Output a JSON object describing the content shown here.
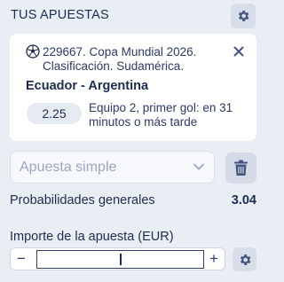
{
  "header": {
    "title": "TUS APUESTAS",
    "settings_icon": "gear-icon"
  },
  "bet": {
    "sport_icon": "soccer-ball-icon",
    "event": "229667. Copa Mundial 2026. Clasificación. Sudamérica.",
    "match": "Ecuador - Argentina",
    "odds": "2.25",
    "selection": "Equipo 2, primer gol: en 31 minutos o más tarde",
    "remove_icon": "close-icon"
  },
  "bet_type": {
    "selected": "Apuesta simple",
    "dropdown_icon": "chevron-down-icon",
    "delete_icon": "trash-icon"
  },
  "summary": {
    "probabilities_label": "Probabilidades generales",
    "probabilities_value": "3.04"
  },
  "stake": {
    "label": "Importe de la apuesta (EUR)",
    "value": "",
    "minus": "−",
    "plus": "+",
    "settings_icon": "gear-icon"
  },
  "colors": {
    "background": "#e9eef4",
    "text": "#1c2c4f",
    "card": "#ffffff",
    "muted": "#9aa6be"
  }
}
